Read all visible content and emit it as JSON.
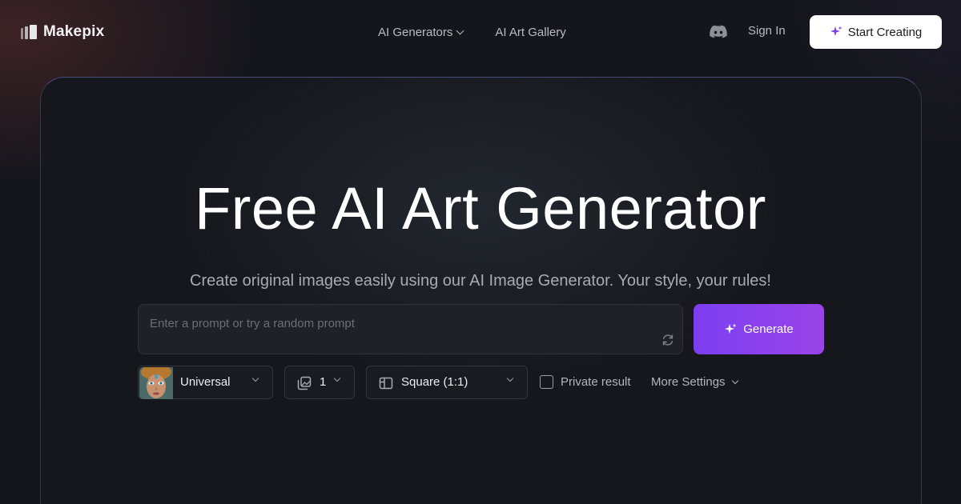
{
  "brand": {
    "name": "Makepix"
  },
  "nav": {
    "items": [
      {
        "label": "AI Generators",
        "has_dropdown": true
      },
      {
        "label": "AI Art Gallery",
        "has_dropdown": false
      }
    ],
    "discord_icon": "discord-icon",
    "sign_in_label": "Sign In",
    "start_creating_label": "Start Creating"
  },
  "hero": {
    "title": "Free AI Art Generator",
    "subtitle": "Create original images easily using our AI Image Generator. Your style, your rules!"
  },
  "prompt": {
    "placeholder": "Enter a prompt or try a random prompt",
    "value": "",
    "random_icon": "refresh-icon"
  },
  "generate_button": {
    "label": "Generate",
    "icon": "sparkle-icon"
  },
  "controls": {
    "model": {
      "label": "Universal"
    },
    "count": {
      "label": "1"
    },
    "ratio": {
      "label": "Square (1:1)"
    },
    "private": {
      "label": "Private result",
      "checked": false
    },
    "more_settings": {
      "label": "More Settings"
    }
  },
  "colors": {
    "background": "#15161c",
    "accent": "#8a42ec",
    "text_muted": "#b9bac2"
  }
}
